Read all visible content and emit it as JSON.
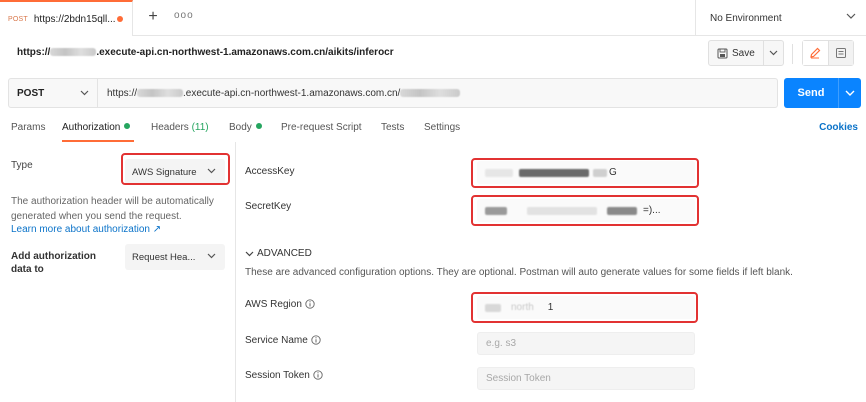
{
  "tab": {
    "method": "POST",
    "url": "https://2bdn15qll..."
  },
  "tabbar": {
    "new_tab": "+",
    "more": "ooo",
    "environment": "No Environment"
  },
  "title": {
    "prefix": "https://",
    "suffix": ".execute-api.cn-northwest-1.amazonaws.com.cn/aikits/inferocr"
  },
  "toolbar": {
    "save_label": "Save"
  },
  "request": {
    "method": "POST",
    "url_prefix": "https://",
    "url_mid": ".execute-api.cn-northwest-1.amazonaws.com.cn/",
    "send_label": "Send"
  },
  "tabs": {
    "params": "Params",
    "authorization": "Authorization",
    "headers": "Headers",
    "headers_count": "(11)",
    "body": "Body",
    "prerequest": "Pre-request Script",
    "tests": "Tests",
    "settings": "Settings",
    "cookies": "Cookies"
  },
  "auth": {
    "type_label": "Type",
    "type_value": "AWS Signature",
    "description": "The authorization header will be automatically generated when you send the request.",
    "learn_more": "Learn more about authorization ↗",
    "add_label": "Add authorization data to",
    "add_value": "Request Hea..."
  },
  "fields": {
    "access_key_label": "AccessKey",
    "access_key_visible_tail": "G",
    "secret_key_label": "SecretKey",
    "secret_key_visible_tail": "=)...",
    "advanced_label": "ADVANCED",
    "advanced_desc": "These are advanced configuration options. They are optional. Postman will auto generate values for some fields if left blank.",
    "region_label": "AWS Region",
    "region_visible": "north",
    "region_tail": "1",
    "service_label": "Service Name",
    "service_placeholder": "e.g. s3",
    "session_label": "Session Token",
    "session_placeholder": "Session Token"
  },
  "colors": {
    "accent": "#ff6c37",
    "send": "#0a84ff",
    "link": "#0b73c9",
    "green": "#25a55f",
    "annotation": "#e23232"
  }
}
